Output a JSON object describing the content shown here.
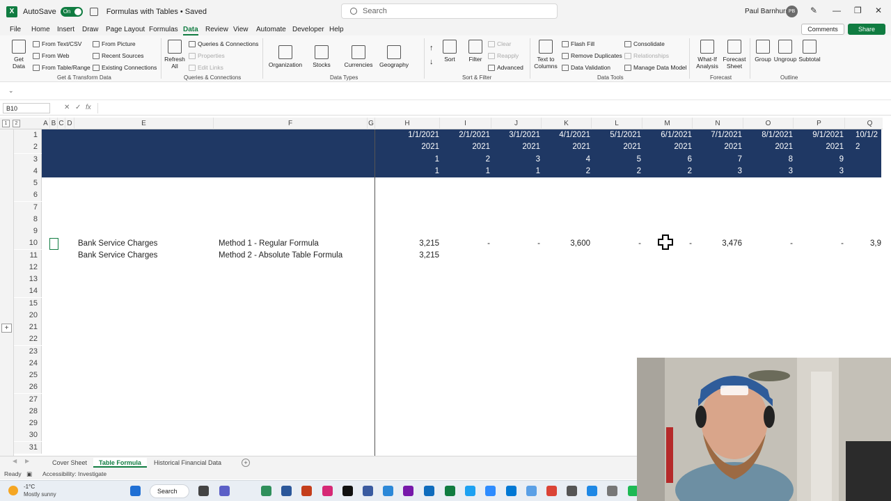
{
  "titlebar": {
    "autosave_label": "AutoSave",
    "autosave_state": "On",
    "doc_title": "Formulas with Tables • Saved",
    "search_placeholder": "Search",
    "user_name": "Paul Barnhurst",
    "user_initials": "PB"
  },
  "tabs": [
    "File",
    "Home",
    "Insert",
    "Draw",
    "Page Layout",
    "Formulas",
    "Data",
    "Review",
    "View",
    "Automate",
    "Developer",
    "Help"
  ],
  "active_tab": "Data",
  "actions": {
    "comments": "Comments",
    "share": "Share"
  },
  "ribbon": {
    "get_data": "Get Data",
    "from_text_csv": "From Text/CSV",
    "from_web": "From Web",
    "from_table_range": "From Table/Range",
    "from_picture": "From Picture",
    "recent_sources": "Recent Sources",
    "existing_connections": "Existing Connections",
    "group_get_transform": "Get & Transform Data",
    "refresh_all": "Refresh All",
    "queries_connections": "Queries & Connections",
    "properties": "Properties",
    "edit_links": "Edit Links",
    "group_queries": "Queries & Connections",
    "organization": "Organization",
    "stocks": "Stocks",
    "currencies": "Currencies",
    "geography": "Geography",
    "group_data_types": "Data Types",
    "sort": "Sort",
    "filter": "Filter",
    "clear": "Clear",
    "reapply": "Reapply",
    "advanced": "Advanced",
    "group_sort_filter": "Sort & Filter",
    "text_to_columns": "Text to Columns",
    "flash_fill": "Flash Fill",
    "remove_duplicates": "Remove Duplicates",
    "data_validation": "Data Validation",
    "consolidate": "Consolidate",
    "relationships": "Relationships",
    "manage_data_model": "Manage Data Model",
    "group_data_tools": "Data Tools",
    "what_if": "What-If Analysis",
    "forecast_sheet": "Forecast Sheet",
    "group_forecast": "Forecast",
    "group": "Group",
    "ungroup": "Ungroup",
    "subtotal": "Subtotal",
    "group_outline": "Outline"
  },
  "formula_bar": {
    "name_box": "B10",
    "fx": "fx",
    "value": ""
  },
  "columns": [
    "A",
    "B",
    "C",
    "D",
    "E",
    "F",
    "G",
    "H",
    "I",
    "J",
    "K",
    "L",
    "M",
    "N",
    "O",
    "P",
    "Q"
  ],
  "outline_levels": [
    "1",
    "2"
  ],
  "rows": [
    "1",
    "2",
    "3",
    "4",
    "5",
    "6",
    "7",
    "8",
    "9",
    "10",
    "11",
    "12",
    "13",
    "14",
    "15",
    "20",
    "21",
    "22",
    "23",
    "24",
    "25",
    "26",
    "27",
    "28",
    "29",
    "30",
    "31"
  ],
  "header_band": {
    "row1": [
      "1/1/2021",
      "2/1/2021",
      "3/1/2021",
      "4/1/2021",
      "5/1/2021",
      "6/1/2021",
      "7/1/2021",
      "8/1/2021",
      "9/1/2021",
      "10/1/2"
    ],
    "row2": [
      "2021",
      "2021",
      "2021",
      "2021",
      "2021",
      "2021",
      "2021",
      "2021",
      "2021",
      "2"
    ],
    "row3": [
      "1",
      "2",
      "3",
      "4",
      "5",
      "6",
      "7",
      "8",
      "9",
      ""
    ],
    "row4": [
      "1",
      "1",
      "1",
      "2",
      "2",
      "2",
      "3",
      "3",
      "3",
      ""
    ]
  },
  "data_rows": [
    {
      "account": "Bank Service Charges",
      "method": "Method 1 - Regular Formula",
      "values": [
        "3,215",
        "-",
        "-",
        "3,600",
        "-",
        "-",
        "3,476",
        "-",
        "-",
        "3,9"
      ]
    },
    {
      "account": "Bank Service Charges",
      "method": "Method 2 - Absolute Table Formula",
      "values": [
        "3,215",
        "",
        "",
        "",
        "",
        "",
        "",
        "",
        "",
        ""
      ]
    }
  ],
  "sheet_tabs": [
    "Cover Sheet",
    "Table Formula",
    "Historical Financial Data"
  ],
  "active_sheet": "Table Formula",
  "status": {
    "ready": "Ready",
    "accessibility": "Accessibility: Investigate"
  },
  "taskbar": {
    "temperature": "-1°C",
    "weather": "Mostly sunny",
    "search": "Search"
  }
}
